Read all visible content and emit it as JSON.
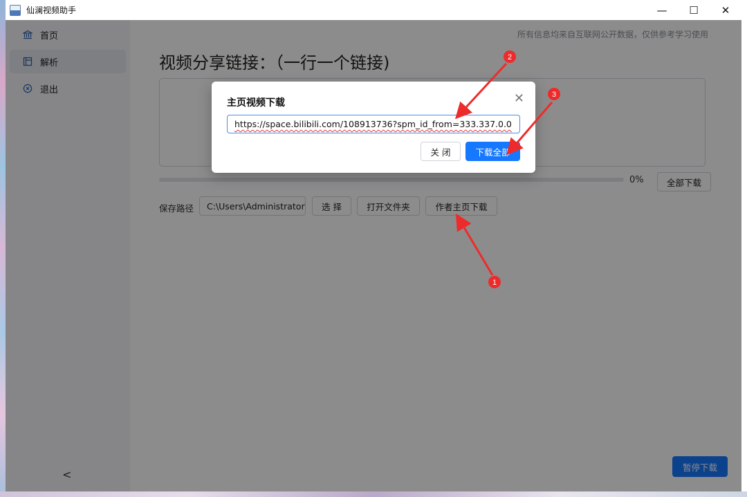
{
  "window": {
    "title": "仙澜视频助手",
    "controls": {
      "minimize": "—",
      "maximize": "☐",
      "close": "✕"
    }
  },
  "sidebar": {
    "items": [
      {
        "label": "首页",
        "icon": "bank-icon",
        "active": false
      },
      {
        "label": "解析",
        "icon": "layout-icon",
        "active": true
      },
      {
        "label": "退出",
        "icon": "close-circle-icon",
        "active": false
      }
    ],
    "collapse_glyph": "<"
  },
  "main": {
    "notice": "所有信息均来自互联网公开数据，仅供参考学习使用",
    "heading": "视频分享链接：（一行一个链接)",
    "links_value": "",
    "progress": {
      "percent": 0,
      "label": "0%"
    },
    "download_all": "全部下载",
    "save_path_label": "保存路径",
    "save_path_value": "C:\\Users\\Administrator\\",
    "choose": "选 择",
    "open_folder": "打开文件夹",
    "author_download": "作者主页下载",
    "pause_download": "暂停下载"
  },
  "modal": {
    "title": "主页视频下载",
    "url_value": "https://space.bilibili.com/108913736?spm_id_from=333.337.0.0",
    "close_label": "关 闭",
    "download_all_label": "下载全部"
  },
  "annotations": {
    "marker1": "1",
    "marker2": "2",
    "marker3": "3",
    "color": "#ee2b2b"
  },
  "colors": {
    "primary": "#1677ff",
    "accent_icon": "#2b5fb0"
  }
}
